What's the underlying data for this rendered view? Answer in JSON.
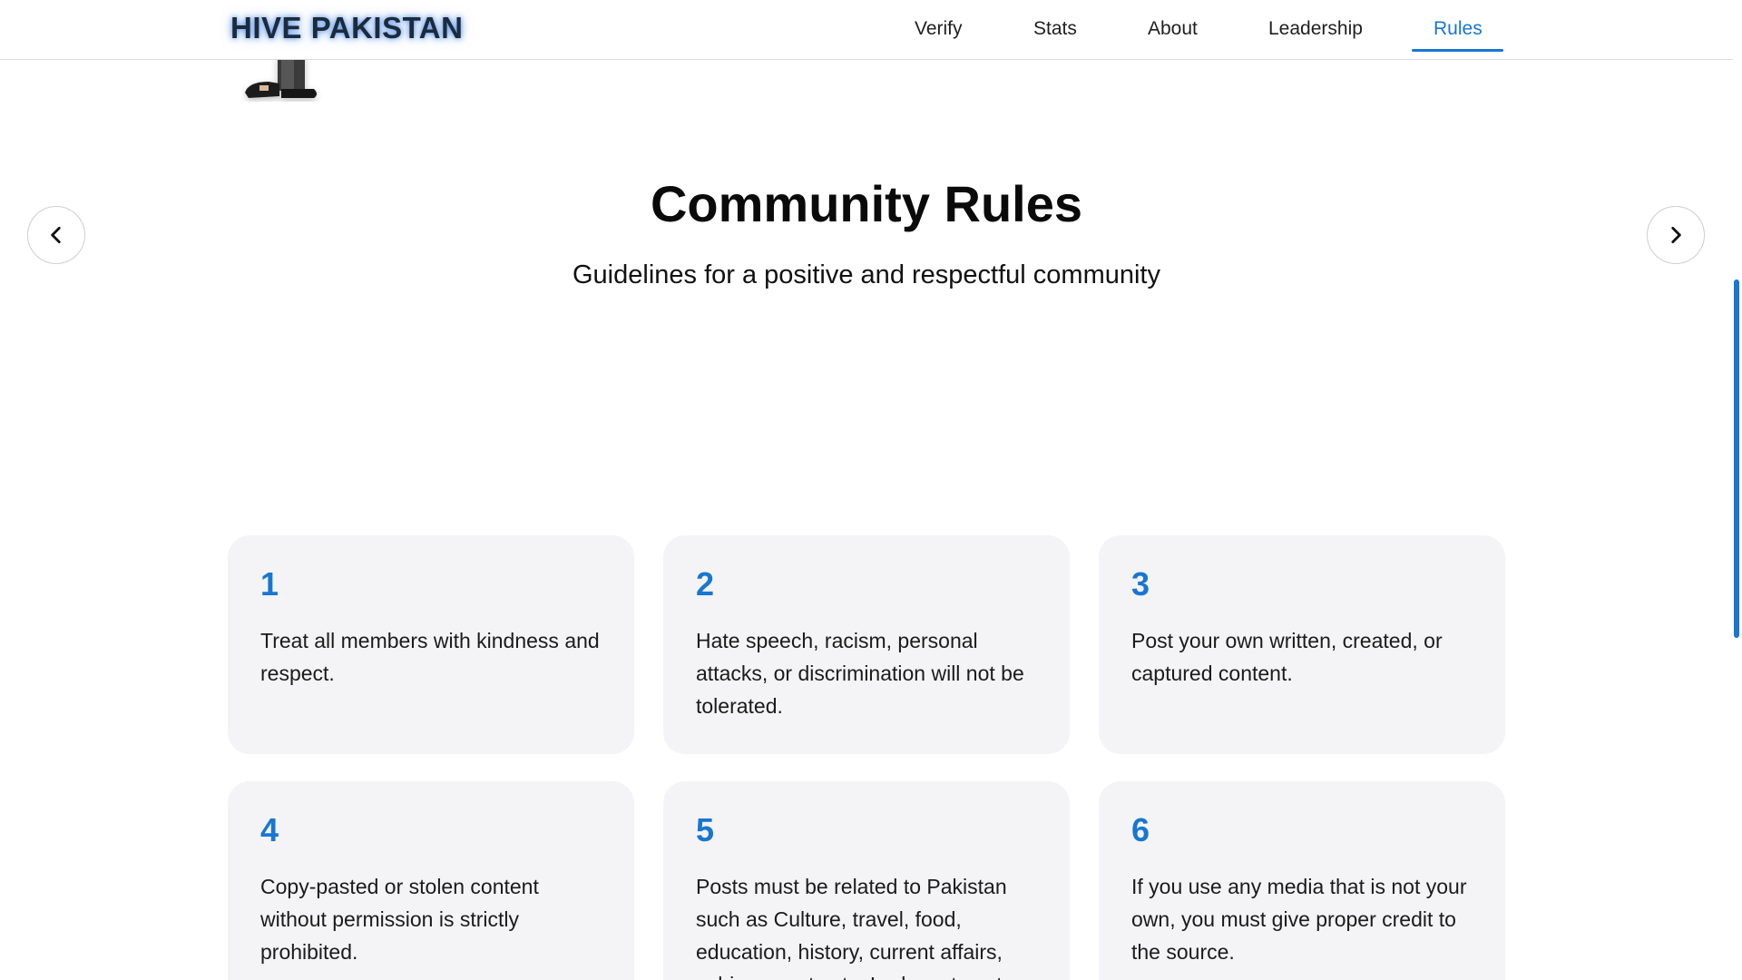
{
  "header": {
    "logo": "HIVE PAKISTAN",
    "nav": [
      {
        "label": "Verify",
        "active": false
      },
      {
        "label": "Stats",
        "active": false
      },
      {
        "label": "About",
        "active": false
      },
      {
        "label": "Leadership",
        "active": false
      },
      {
        "label": "Rules",
        "active": true
      }
    ]
  },
  "section": {
    "title": "Community Rules",
    "subtitle": "Guidelines for a positive and respectful community"
  },
  "rules": [
    {
      "number": "1",
      "text": "Treat all members with kindness and respect."
    },
    {
      "number": "2",
      "text": "Hate speech, racism, personal attacks, or discrimination will not be tolerated."
    },
    {
      "number": "3",
      "text": "Post your own written, created, or captured content."
    },
    {
      "number": "4",
      "text": "Copy-pasted or stolen content without permission is strictly prohibited."
    },
    {
      "number": "5",
      "text": "Posts must be related to Pakistan such as Culture, travel, food, education, history, current affairs, achievements etc. Irrelevant posts"
    },
    {
      "number": "6",
      "text": "If you use any media that is not your own, you must give proper credit to the source."
    }
  ],
  "icons": {
    "prev": "chevron-left-icon",
    "next": "chevron-right-icon"
  },
  "colors": {
    "accent": "#1976d2",
    "card_bg": "#f4f4f6",
    "text": "#111111"
  }
}
